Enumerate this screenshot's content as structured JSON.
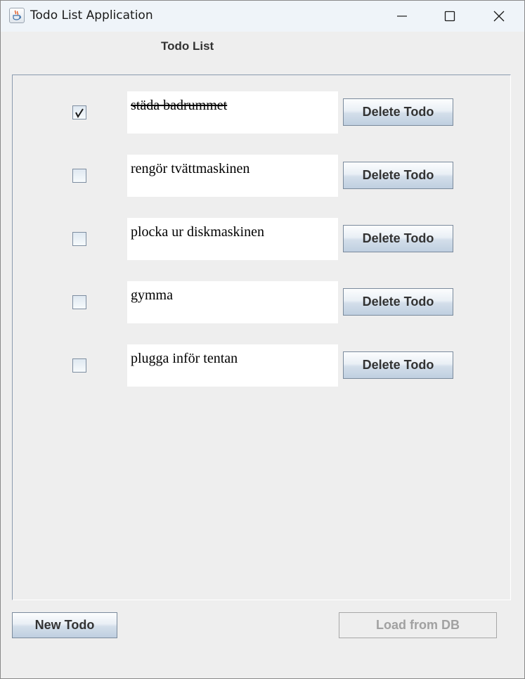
{
  "window": {
    "title": "Todo List Application",
    "icon": "java-cup-icon"
  },
  "heading": "Todo List",
  "todos": [
    {
      "text": "städa badrummet",
      "done": true,
      "delete_label": "Delete Todo"
    },
    {
      "text": "rengör tvättmaskinen",
      "done": false,
      "delete_label": "Delete Todo"
    },
    {
      "text": "plocka ur diskmaskinen",
      "done": false,
      "delete_label": "Delete Todo"
    },
    {
      "text": "gymma",
      "done": false,
      "delete_label": "Delete Todo"
    },
    {
      "text": "plugga inför tentan",
      "done": false,
      "delete_label": "Delete Todo"
    }
  ],
  "footer": {
    "new_label": "New Todo",
    "load_label": "Load from DB",
    "load_enabled": false
  },
  "colors": {
    "background": "#eeeeee",
    "titlebar": "#eff4f9",
    "button_gradient_top": "#fcfdfe",
    "button_gradient_bottom": "#bfcfe0",
    "disabled_text": "#a1a1a1"
  }
}
